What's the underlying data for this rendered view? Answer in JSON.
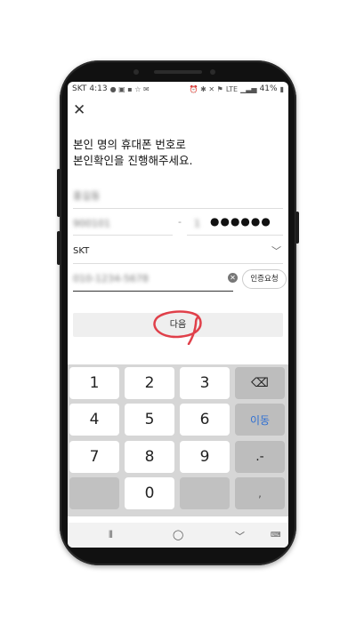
{
  "status_bar": {
    "carrier": "SKT",
    "time": "4:13",
    "lte": "LTE",
    "battery": "41%"
  },
  "form": {
    "title_line1": "본인 명의 휴대폰 번호로",
    "title_line2": "본인확인을 진행해주세요.",
    "name_value": "홍길동",
    "id_front_value": "900101",
    "id_dash": "-",
    "id_back_first_digit": "1",
    "id_back_masked": "●●●●●●",
    "carrier_value": "SKT",
    "phone_value": "010-1234-5678",
    "verify_button": "인증요청",
    "next_button": "다음"
  },
  "keypad": {
    "rows": [
      [
        "1",
        "2",
        "3"
      ],
      [
        "4",
        "5",
        "6"
      ],
      [
        "7",
        "8",
        "9"
      ],
      [
        "",
        "0",
        ""
      ]
    ],
    "move_label": "이동",
    "dot_dash_label": ".-",
    "comma_label": ","
  },
  "colors": {
    "accent_blue": "#2e6fd3",
    "annotation_red": "#e0404a"
  }
}
